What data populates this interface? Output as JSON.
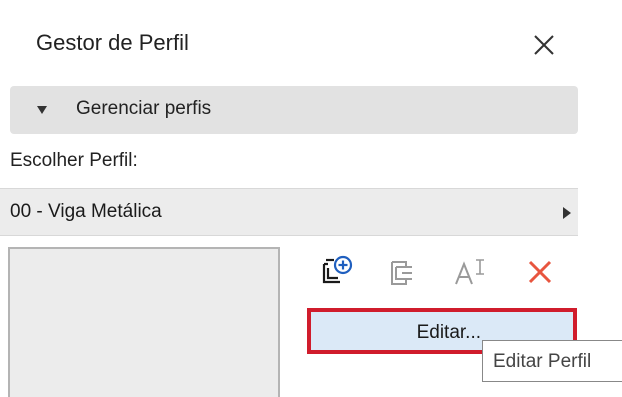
{
  "window": {
    "title": "Gestor de Perfil",
    "close_icon": "close-icon"
  },
  "section": {
    "label": "Gerenciar perfis",
    "expanded": true,
    "arrow_icon": "triangle-down-icon"
  },
  "profile": {
    "choose_label": "Escolher Perfil:",
    "selected": "00 - Viga Metálica",
    "arrow_icon": "triangle-right-icon"
  },
  "toolbar": {
    "icons": [
      "new-profile-icon",
      "duplicate-profile-icon",
      "rename-profile-icon",
      "delete-profile-icon"
    ],
    "edit_label": "Editar...",
    "tooltip": "Editar Perfil"
  },
  "colors": {
    "highlight_border": "#d01c2c",
    "button_bg": "#dbe9f7",
    "delete_icon": "#e8553f",
    "new_icon": "#1f5fbf",
    "disabled_icon": "#9a9a9a"
  }
}
